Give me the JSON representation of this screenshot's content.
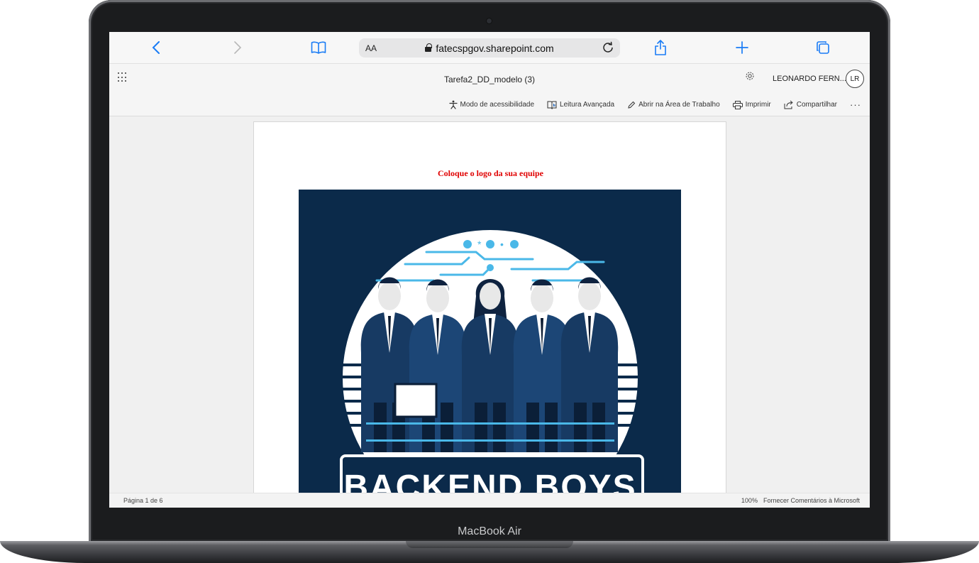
{
  "device": {
    "label": "MacBook Air"
  },
  "browser": {
    "url_text_size_label": "AA",
    "url": "fatecspgov.sharepoint.com",
    "icons": [
      "back-icon",
      "forward-icon",
      "bookmarks-icon",
      "lock-icon",
      "reload-icon",
      "share-icon",
      "new-tab-icon",
      "tabs-icon"
    ],
    "accent_color": "#1a7cf5"
  },
  "word": {
    "doc_title": "Tarefa2_DD_modelo (3)",
    "user_name": "LEONARDO FERN...",
    "user_initials": "LR",
    "toolbar": {
      "accessibility": "Modo de acessibilidade",
      "immersive_reader": "Leitura Avançada",
      "open_desktop": "Abrir na Área de Trabalho",
      "print": "Imprimir",
      "share": "Compartilhar",
      "more": "···"
    },
    "status": {
      "page_info": "Página 1 de 6",
      "zoom": "100%",
      "feedback": "Fornecer Comentários à Microsoft"
    }
  },
  "document": {
    "heading": "Coloque o logo da sua equipe",
    "heading_color": "#e00000",
    "logo_text": "BACKEND BOYS",
    "logo_bg_color": "#0b2a4a",
    "logo_accent_color": "#4ab8e8"
  }
}
